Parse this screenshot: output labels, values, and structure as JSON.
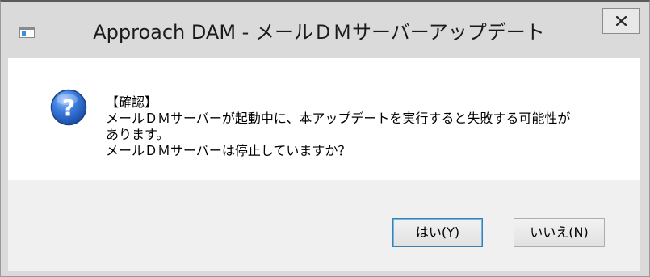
{
  "window": {
    "title": "Approach DAM - メールＤＭサーバーアップデート",
    "close_label": "x"
  },
  "dialog": {
    "icon": "question-icon",
    "message_lines": [
      "【確認】",
      "メールＤＭサーバーが起動中に、本アップデートを実行すると失敗する可能性が",
      "あります。",
      "メールＤＭサーバーは停止していますか？"
    ]
  },
  "buttons": {
    "yes_label": "はい(Y)",
    "no_label": "いいえ(N)"
  },
  "colors": {
    "titlebar": "#dadada",
    "content_bg": "#ffffff",
    "footer_bg": "#f0f0f0",
    "icon_blue": "#1f5fb4",
    "default_button_border": "#3c7fb1"
  }
}
